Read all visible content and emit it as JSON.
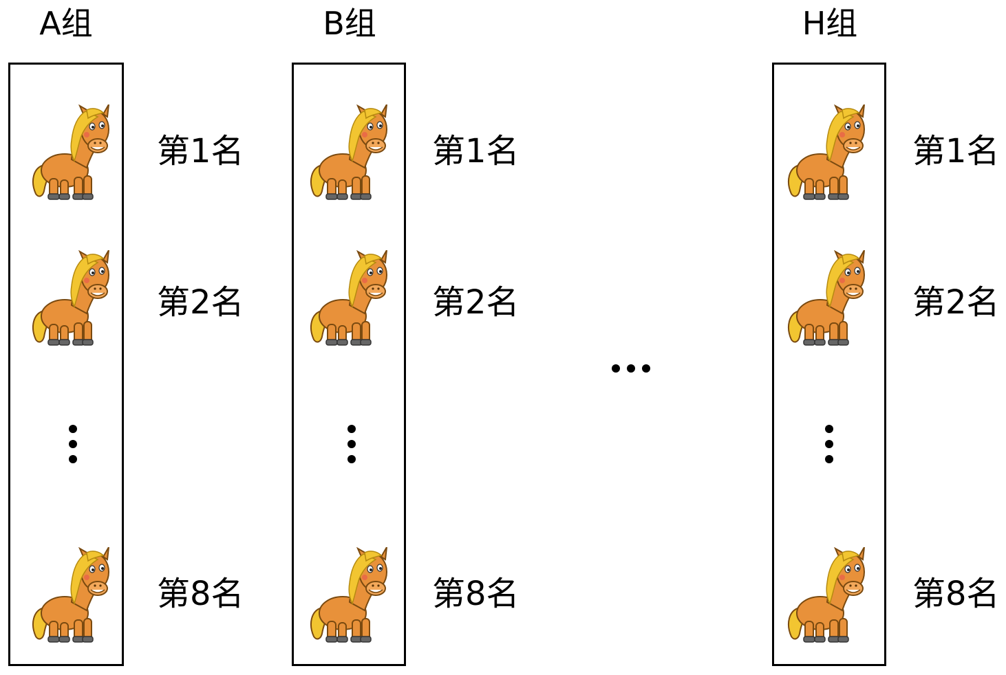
{
  "groups": [
    {
      "title": "A组",
      "ranks": [
        "第1名",
        "第2名",
        "第8名"
      ]
    },
    {
      "title": "B组",
      "ranks": [
        "第1名",
        "第2名",
        "第8名"
      ]
    },
    {
      "title": "H组",
      "ranks": [
        "第1名",
        "第2名",
        "第8名"
      ]
    }
  ],
  "icons": {
    "horse": "horse-icon",
    "vertical_ellipsis": "vertical-ellipsis",
    "horizontal_ellipsis": "horizontal-ellipsis"
  },
  "colors": {
    "horse_body": "#e8913a",
    "horse_mane": "#f2c531",
    "hoof": "#666666",
    "outline": "#000000"
  }
}
